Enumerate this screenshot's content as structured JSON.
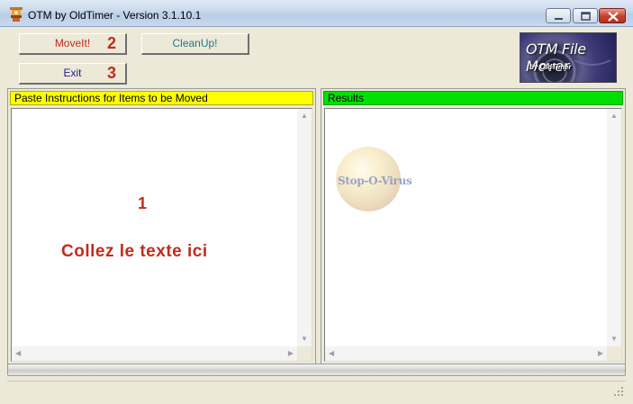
{
  "window": {
    "title": "OTM by OldTimer - Version 3.1.10.1",
    "icon": "app-icon"
  },
  "toolbar": {
    "moveit_label": "MoveIt!",
    "cleanup_label": "CleanUp!",
    "exit_label": "Exit",
    "moveit_step": "2",
    "exit_step": "3"
  },
  "logo": {
    "title": "OTM File Mover",
    "subtitle": "by OldTimer"
  },
  "instructions_panel": {
    "header": "Paste Instructions for Items to be Moved",
    "step": "1",
    "hint": "Collez le texte ici"
  },
  "results_panel": {
    "header": "Results",
    "watermark": "Stop-O-Virus"
  },
  "progress": {
    "value": 0
  },
  "colors": {
    "instructions_header": "#ffff00",
    "results_header": "#00e000",
    "step_red": "#c32b1b"
  }
}
